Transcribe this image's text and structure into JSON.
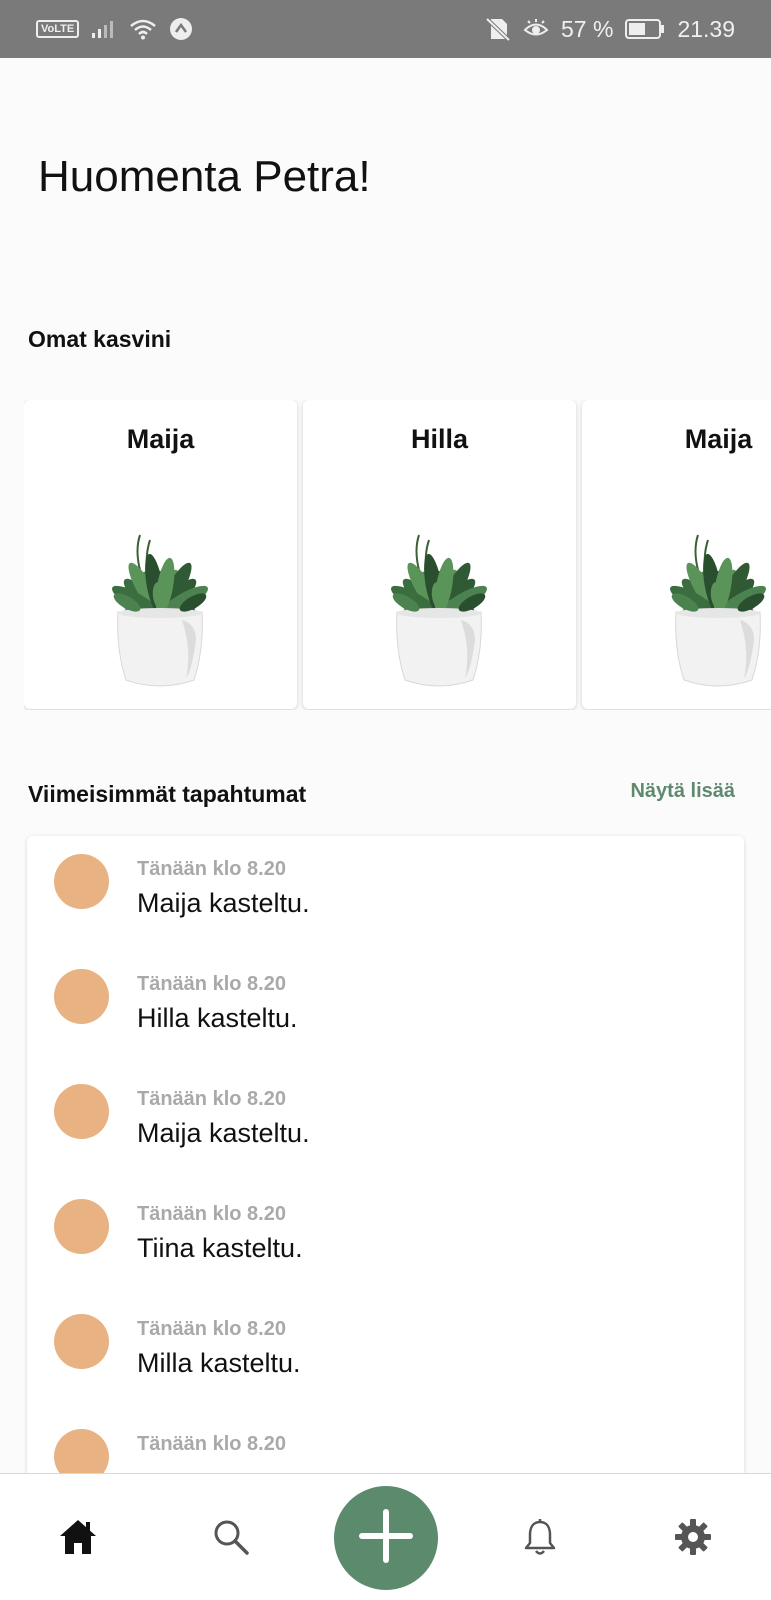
{
  "status_bar": {
    "network_badge": "VoLTE",
    "battery_percent": "57 %",
    "time": "21.39",
    "icons": [
      "signal-icon",
      "wifi-icon",
      "data-saver-icon",
      "no-sim-icon",
      "eye-comfort-icon",
      "battery-icon"
    ],
    "battery_level": 0.57
  },
  "greeting": "Huomenta Petra!",
  "plants_section": {
    "title": "Omat kasvini",
    "plants": [
      {
        "name": "Maija"
      },
      {
        "name": "Hilla"
      },
      {
        "name": "Maija"
      }
    ]
  },
  "events_section": {
    "title": "Viimeisimmät tapahtumat",
    "show_more": "Näytä lisää",
    "events": [
      {
        "time": "Tänään klo 8.20",
        "text": "Maija kasteltu."
      },
      {
        "time": "Tänään klo 8.20",
        "text": "Hilla kasteltu."
      },
      {
        "time": "Tänään klo 8.20",
        "text": "Maija kasteltu."
      },
      {
        "time": "Tänään klo 8.20",
        "text": "Tiina kasteltu."
      },
      {
        "time": "Tänään klo 8.20",
        "text": "Milla kasteltu."
      },
      {
        "time": "Tänään klo 8.20",
        "text": ""
      }
    ]
  },
  "bottom_nav": {
    "items": [
      "home-icon",
      "search-icon",
      "add-icon",
      "bell-icon",
      "gear-icon"
    ]
  },
  "colors": {
    "accent": "#5c8a6c",
    "event_dot": "#e9b283",
    "link": "#5f8a6e",
    "muted_text": "#a9a9a9",
    "status_bar": "#7a7a7a"
  }
}
